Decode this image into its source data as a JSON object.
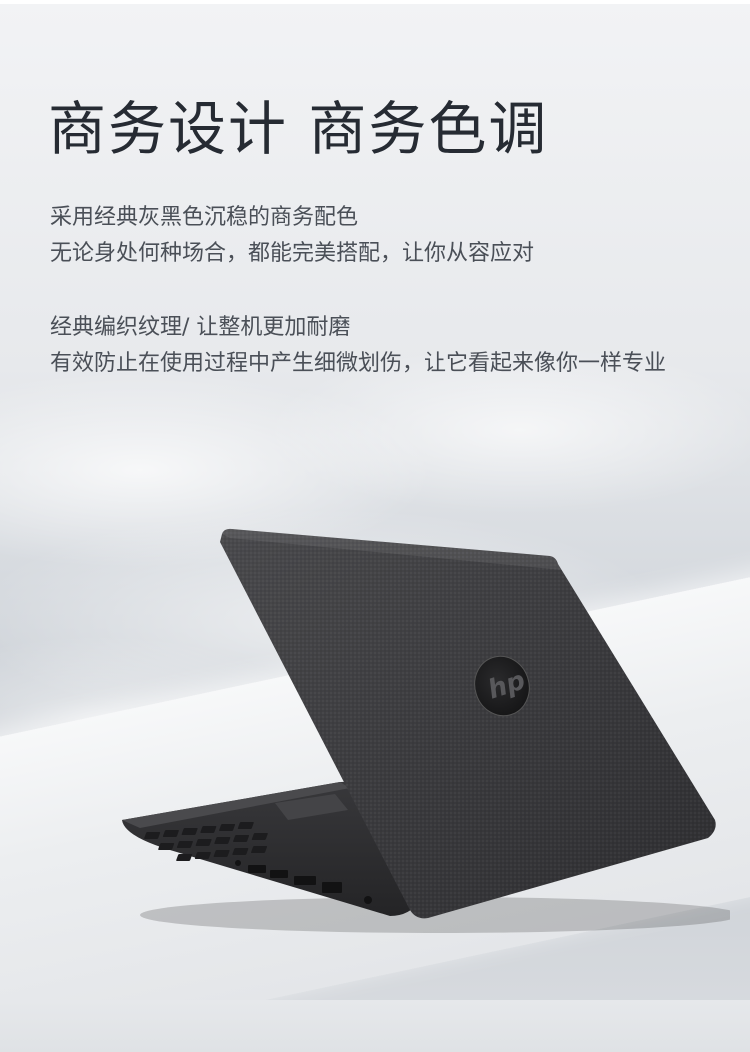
{
  "headline": "商务设计 商务色调",
  "paragraph_1": {
    "line_1": "采用经典灰黑色沉稳的商务配色",
    "line_2": "无论身处何种场合，都能完美搭配，让你从容应对"
  },
  "paragraph_2": {
    "line_1": "经典编织纹理/ 让整机更加耐磨",
    "line_2": "有效防止在使用过程中产生细微划伤，让它看起来像你一样专业"
  },
  "laptop": {
    "logo_text": "hp",
    "color": "#3a3a3c"
  }
}
